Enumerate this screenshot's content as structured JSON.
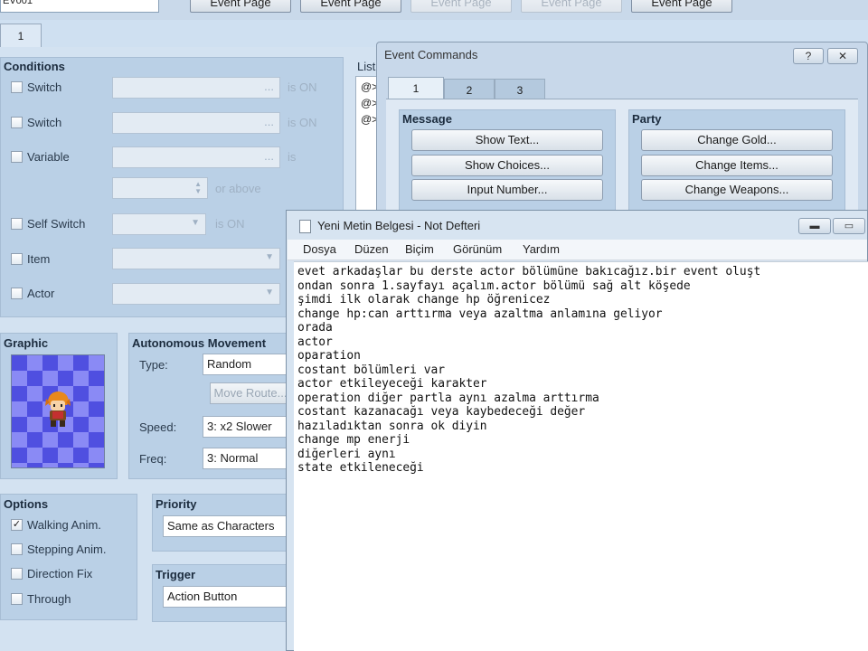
{
  "toolbar": {
    "name_value": "EV001",
    "page_buttons": [
      "Event Page",
      "Event Page",
      "Event Page",
      "Event Page",
      "Event Page"
    ]
  },
  "tabs": [
    "1"
  ],
  "conditions": {
    "title": "Conditions",
    "switch1": "Switch",
    "switch2": "Switch",
    "variable": "Variable",
    "self_switch": "Self Switch",
    "item": "Item",
    "actor": "Actor",
    "is_on": "is ON",
    "is": "is",
    "or_above": "or above",
    "ellipsis": "..."
  },
  "graphic": {
    "title": "Graphic"
  },
  "autonomous": {
    "title": "Autonomous Movement",
    "type_label": "Type:",
    "type_value": "Random",
    "move_route": "Move Route...",
    "speed_label": "Speed:",
    "speed_value": "3: x2 Slower",
    "freq_label": "Freq:",
    "freq_value": "3: Normal"
  },
  "options": {
    "title": "Options",
    "walking": "Walking Anim.",
    "stepping": "Stepping Anim.",
    "direction_fix": "Direction Fix",
    "through": "Through"
  },
  "priority": {
    "title": "Priority",
    "value": "Same as Characters"
  },
  "trigger": {
    "title": "Trigger",
    "value": "Action Button"
  },
  "list": {
    "label": "List of Event Commands:",
    "rows": [
      "@>",
      "@>",
      "@>"
    ]
  },
  "event_commands": {
    "title": "Event Commands",
    "help": "?",
    "close": "✕",
    "tabs": [
      "1",
      "2",
      "3"
    ],
    "message": {
      "title": "Message",
      "buttons": [
        "Show Text...",
        "Show Choices...",
        "Input Number..."
      ]
    },
    "party": {
      "title": "Party",
      "buttons": [
        "Change Gold...",
        "Change Items...",
        "Change Weapons..."
      ]
    }
  },
  "notepad": {
    "title": "Yeni Metin Belgesi - Not Defteri",
    "menu": [
      "Dosya",
      "Düzen",
      "Biçim",
      "Görünüm",
      "Yardım"
    ],
    "lines": [
      "evet arkadaşlar bu derste actor bölümüne bakıcağız.bir event oluşt",
      "ondan sonra 1.sayfayı açalım.actor bölümü sağ alt köşede",
      "şimdi ilk olarak change hp öğrenicez",
      "change hp:can arttırma veya azaltma anlamına geliyor",
      "orada",
      "actor",
      "oparation",
      "costant bölümleri var",
      "actor etkileyeceği karakter",
      "operation diğer partla aynı azalma arttırma",
      "costant kazanacağı veya kaybedeceği değer",
      "hazıladıktan sonra ok diyin",
      "change mp enerji",
      "diğerleri aynı",
      "state etkileneceği"
    ]
  }
}
